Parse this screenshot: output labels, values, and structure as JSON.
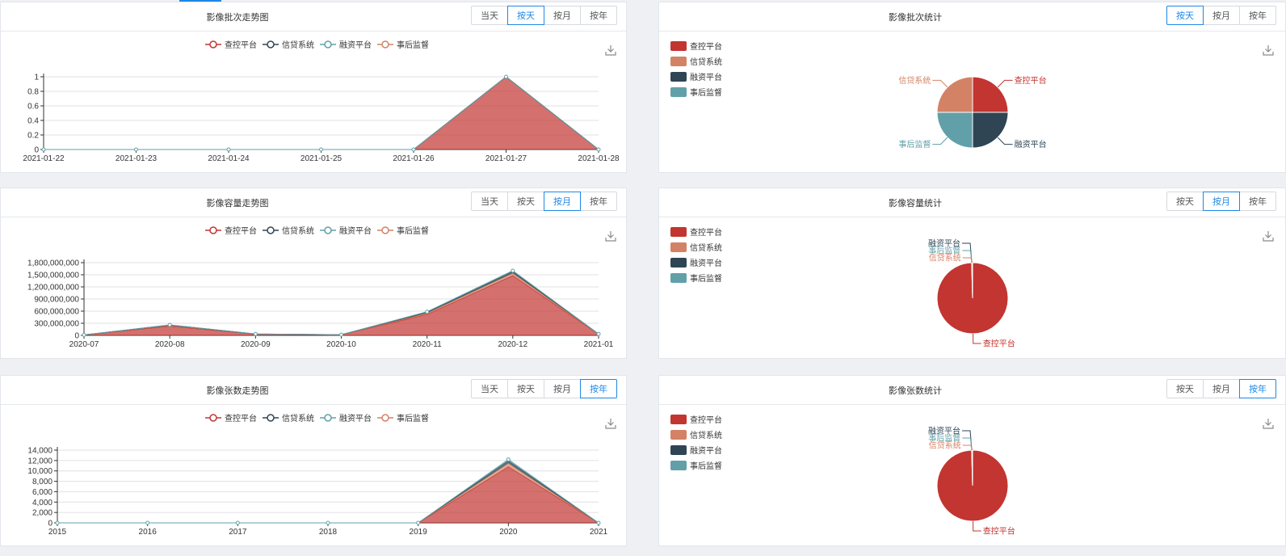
{
  "colors": {
    "red": "#c23531",
    "salmon": "#d48265",
    "navy": "#2f4554",
    "teal": "#61a0a8",
    "accent": "#1e88e5"
  },
  "icons": {
    "download": "download-icon"
  },
  "panels": [
    {
      "id": "batch-trend",
      "title": "影像批次走势图",
      "buttons": [
        "当天",
        "按天",
        "按月",
        "按年"
      ],
      "active": "按天"
    },
    {
      "id": "batch-stats",
      "title": "影像批次统计",
      "buttons": [
        "按天",
        "按月",
        "按年"
      ],
      "active": "按天"
    },
    {
      "id": "capacity-trend",
      "title": "影像容量走势图",
      "buttons": [
        "当天",
        "按天",
        "按月",
        "按年"
      ],
      "active": "按月"
    },
    {
      "id": "capacity-stats",
      "title": "影像容量统计",
      "buttons": [
        "按天",
        "按月",
        "按年"
      ],
      "active": "按月"
    },
    {
      "id": "count-trend",
      "title": "影像张数走势图",
      "buttons": [
        "当天",
        "按天",
        "按月",
        "按年"
      ],
      "active": "按年"
    },
    {
      "id": "count-stats",
      "title": "影像张数统计",
      "buttons": [
        "按天",
        "按月",
        "按年"
      ],
      "active": "按年"
    }
  ],
  "chart_data": [
    {
      "type": "area",
      "legend": [
        "查控平台",
        "信贷系统",
        "融资平台",
        "事后监督"
      ],
      "categories": [
        "2021-01-22",
        "2021-01-23",
        "2021-01-24",
        "2021-01-25",
        "2021-01-26",
        "2021-01-27",
        "2021-01-28"
      ],
      "series": [
        {
          "name": "查控平台",
          "values": [
            0,
            0,
            0,
            0,
            0,
            1,
            0
          ]
        },
        {
          "name": "信贷系统",
          "values": [
            0,
            0,
            0,
            0,
            0,
            0,
            0
          ]
        },
        {
          "name": "融资平台",
          "values": [
            0,
            0,
            0,
            0,
            0,
            0,
            0
          ]
        },
        {
          "name": "事后监督",
          "values": [
            0,
            0,
            0,
            0,
            0,
            0,
            0
          ]
        }
      ],
      "yticks": [
        "0",
        "0.2",
        "0.4",
        "0.6",
        "0.8",
        "1"
      ],
      "ylim": [
        0,
        1
      ],
      "grid": true
    },
    {
      "type": "pie",
      "legend": [
        "查控平台",
        "信贷系统",
        "融资平台",
        "事后监督"
      ],
      "slices": [
        {
          "name": "查控平台",
          "value": 1
        },
        {
          "name": "融资平台",
          "value": 1
        },
        {
          "name": "事后监督",
          "value": 1
        },
        {
          "name": "信贷系统",
          "value": 1
        }
      ]
    },
    {
      "type": "area",
      "legend": [
        "查控平台",
        "信贷系统",
        "融资平台",
        "事后监督"
      ],
      "categories": [
        "2020-07",
        "2020-08",
        "2020-09",
        "2020-10",
        "2020-11",
        "2020-12",
        "2021-01"
      ],
      "series": [
        {
          "name": "查控平台",
          "values": [
            10000000,
            230000000,
            30000000,
            15000000,
            520000000,
            1480000000,
            30000000
          ]
        },
        {
          "name": "信贷系统",
          "values": [
            1000000,
            15000000,
            2000000,
            1000000,
            30000000,
            60000000,
            3000000
          ]
        },
        {
          "name": "融资平台",
          "values": [
            1000000,
            10000000,
            2000000,
            1000000,
            25000000,
            40000000,
            2000000
          ]
        },
        {
          "name": "事后监督",
          "values": [
            500000,
            5000000,
            1000000,
            500000,
            10000000,
            20000000,
            1000000
          ]
        }
      ],
      "yticks": [
        "0",
        "300,000,000",
        "600,000,000",
        "900,000,000",
        "1,200,000,000",
        "1,500,000,000",
        "1,800,000,000"
      ],
      "ylim": [
        0,
        1800000000
      ],
      "grid": true
    },
    {
      "type": "pie",
      "legend": [
        "查控平台",
        "信贷系统",
        "融资平台",
        "事后监督"
      ],
      "slices": [
        {
          "name": "查控平台",
          "value": 99.6
        },
        {
          "name": "融资平台",
          "value": 0.1
        },
        {
          "name": "事后监督",
          "value": 0.1
        },
        {
          "name": "信贷系统",
          "value": 0.2
        }
      ]
    },
    {
      "type": "area",
      "legend": [
        "查控平台",
        "信贷系统",
        "融资平台",
        "事后监督"
      ],
      "categories": [
        "2015",
        "2016",
        "2017",
        "2018",
        "2019",
        "2020",
        "2021"
      ],
      "series": [
        {
          "name": "查控平台",
          "values": [
            0,
            0,
            0,
            0,
            0,
            10800,
            0
          ]
        },
        {
          "name": "信贷系统",
          "values": [
            0,
            0,
            0,
            0,
            0,
            700,
            0
          ]
        },
        {
          "name": "融资平台",
          "values": [
            0,
            0,
            0,
            0,
            0,
            400,
            0
          ]
        },
        {
          "name": "事后监督",
          "values": [
            0,
            0,
            0,
            0,
            0,
            300,
            0
          ]
        }
      ],
      "yticks": [
        "0",
        "2,000",
        "4,000",
        "6,000",
        "8,000",
        "10,000",
        "12,000",
        "14,000"
      ],
      "ylim": [
        0,
        14000
      ],
      "grid": true
    },
    {
      "type": "pie",
      "legend": [
        "查控平台",
        "信贷系统",
        "融资平台",
        "事后监督"
      ],
      "slices": [
        {
          "name": "查控平台",
          "value": 99.6
        },
        {
          "name": "融资平台",
          "value": 0.1
        },
        {
          "name": "事后监督",
          "value": 0.1
        },
        {
          "name": "信贷系统",
          "value": 0.2
        }
      ]
    }
  ]
}
